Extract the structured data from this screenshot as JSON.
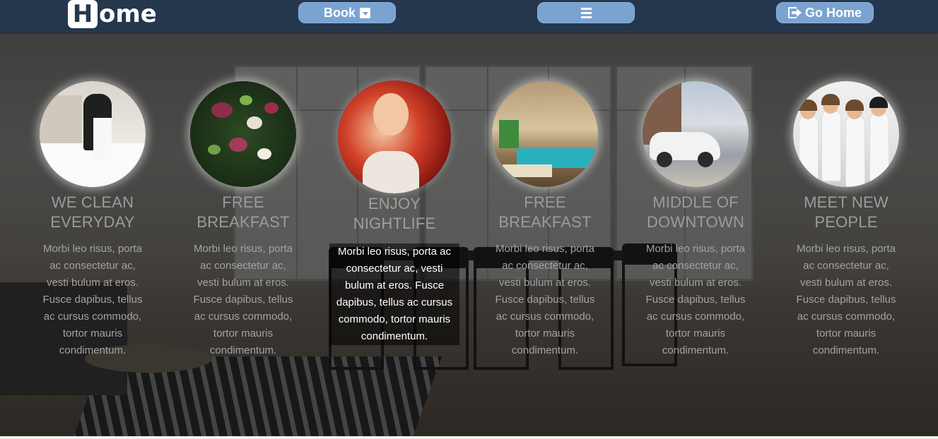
{
  "navbar": {
    "logo_initial": "H",
    "logo_rest": "ome",
    "book_label": "Book",
    "menu_icon": "bars-icon",
    "home_label": "Go Home",
    "home_icon": "sign-out-icon",
    "colors": {
      "bar": "#25374d",
      "button": "#7aa3d2",
      "text": "#ffffff"
    }
  },
  "features": [
    {
      "title": "WE CLEAN EVERYDAY",
      "body": "Morbi leo risus, porta ac consectetur ac, vesti bulum at eros. Fusce dapibus, tellus ac cursus commodo, tortor mauris condimentum.",
      "image": "housekeeper-making-bed"
    },
    {
      "title": "FREE BREAKFAST",
      "body": "Morbi leo risus, porta ac consectetur ac, vesti bulum at eros. Fusce dapibus, tellus ac cursus commodo, tortor mauris condimentum.",
      "image": "salad-bowl"
    },
    {
      "title": "ENJOY NIGHTLIFE",
      "body": "Morbi leo risus, porta ac consectetur ac, vesti bulum at eros. Fusce dapibus, tellus ac cursus commodo, tortor mauris condimentum.",
      "image": "party-woman",
      "active": true
    },
    {
      "title": "FREE BREAKFAST",
      "body": "Morbi leo risus, porta ac consectetur ac, vesti bulum at eros. Fusce dapibus, tellus ac cursus commodo, tortor mauris condimentum.",
      "image": "poolside-lounge"
    },
    {
      "title": "MIDDLE OF DOWNTOWN",
      "body": "Morbi leo risus, porta ac consectetur ac, vesti bulum at eros. Fusce dapibus, tellus ac cursus commodo, tortor mauris condimentum.",
      "image": "vintage-car-street"
    },
    {
      "title": "MEET NEW PEOPLE",
      "body": "Morbi leo risus, porta ac consectetur ac, vesti bulum at eros. Fusce dapibus, tellus ac cursus commodo, tortor mauris condimentum.",
      "image": "group-of-friends"
    }
  ]
}
